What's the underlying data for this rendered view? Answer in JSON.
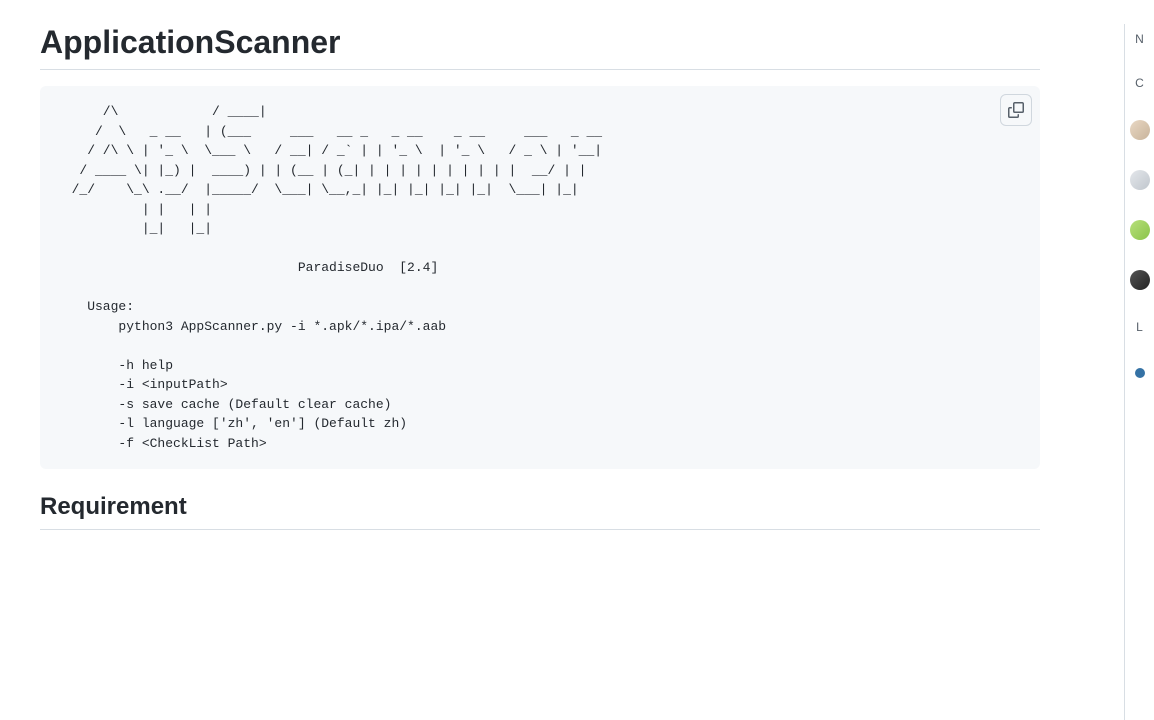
{
  "heading": "ApplicationScanner",
  "code_block": "      /\\            / ____|\n     /  \\   _ __   | (___     ___   __ _   _ __    _ __     ___   _ __\n    / /\\ \\ | '_ \\  \\___ \\   / __| / _` | | '_ \\  | '_ \\   / _ \\ | '__|\n   / ____ \\| |_) |  ____) | | (__ | (_| | | | | | | | | | |  __/ | |\n  /_/    \\_\\ .__/  |_____/  \\___| \\__,_| |_| |_| |_| |_|  \\___| |_|\n           | |   | |\n           |_|   |_|\n\n                               ParadiseDuo  [2.4]\n\n    Usage:\n        python3 AppScanner.py -i *.apk/*.ipa/*.aab\n\n        -h help\n        -i <inputPath>\n        -s save cache (Default clear cache)\n        -l language ['zh', 'en'] (Default zh)\n        -f <CheckList Path>\n",
  "subheading": "Requirement",
  "rail": {
    "label1": "N",
    "label2": "C",
    "label3": "L"
  }
}
